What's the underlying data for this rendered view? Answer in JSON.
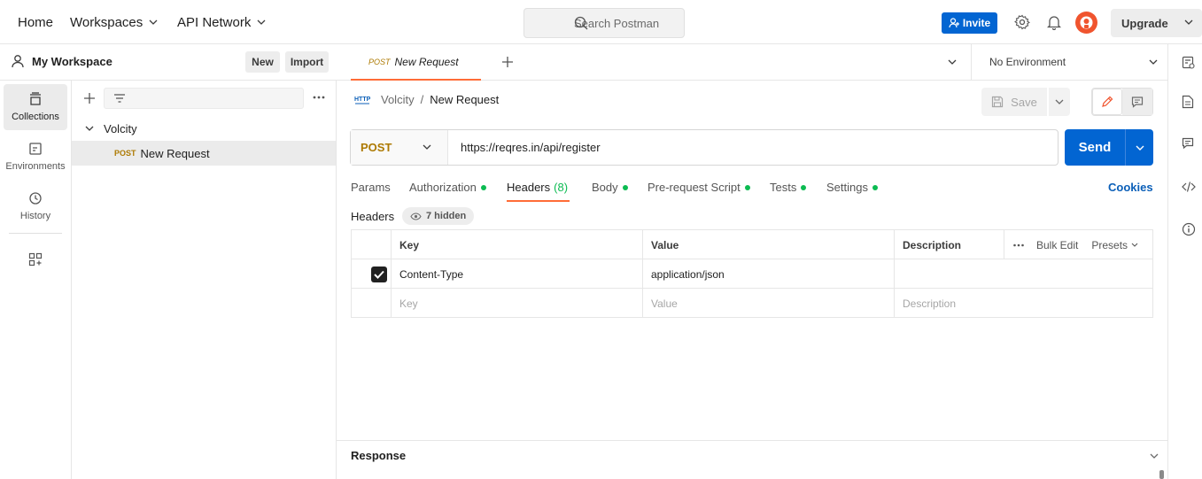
{
  "topbar": {
    "nav": [
      "Home",
      "Workspaces",
      "API Network"
    ],
    "search_placeholder": "Search Postman",
    "invite_label": "Invite",
    "upgrade_label": "Upgrade"
  },
  "workspace": {
    "title": "My Workspace",
    "new_label": "New",
    "import_label": "Import"
  },
  "rail": {
    "items": [
      {
        "label": "Collections",
        "icon": "collections-icon",
        "active": true
      },
      {
        "label": "Environments",
        "icon": "environments-icon",
        "active": false
      },
      {
        "label": "History",
        "icon": "history-icon",
        "active": false
      }
    ]
  },
  "tree": {
    "collection": "Volcity",
    "request_method": "POST",
    "request_name": "New Request"
  },
  "tab": {
    "method": "POST",
    "name": "New Request"
  },
  "environment": {
    "selected": "No Environment"
  },
  "breadcrumb": {
    "collection": "Volcity",
    "separator": "/",
    "request": "New Request"
  },
  "toolbar": {
    "save_label": "Save"
  },
  "request": {
    "method": "POST",
    "url": "https://reqres.in/api/register",
    "send_label": "Send"
  },
  "request_tabs": {
    "params": "Params",
    "authorization": "Authorization",
    "headers": "Headers",
    "headers_count": "(8)",
    "body": "Body",
    "prerequest": "Pre-request Script",
    "tests": "Tests",
    "settings": "Settings",
    "cookies": "Cookies"
  },
  "headers_section": {
    "label": "Headers",
    "hidden": "7 hidden",
    "columns": [
      "Key",
      "Value",
      "Description"
    ],
    "bulk_edit": "Bulk Edit",
    "presets": "Presets",
    "rows": [
      {
        "checked": true,
        "key": "Content-Type",
        "value": "application/json",
        "description": ""
      }
    ],
    "placeholders": {
      "key": "Key",
      "value": "Value",
      "description": "Description"
    }
  },
  "response": {
    "title": "Response"
  },
  "colors": {
    "accent": "#ff6c37",
    "primary": "#0265d2",
    "post_method": "#ad7a03",
    "status_dot": "#0cbb52"
  }
}
